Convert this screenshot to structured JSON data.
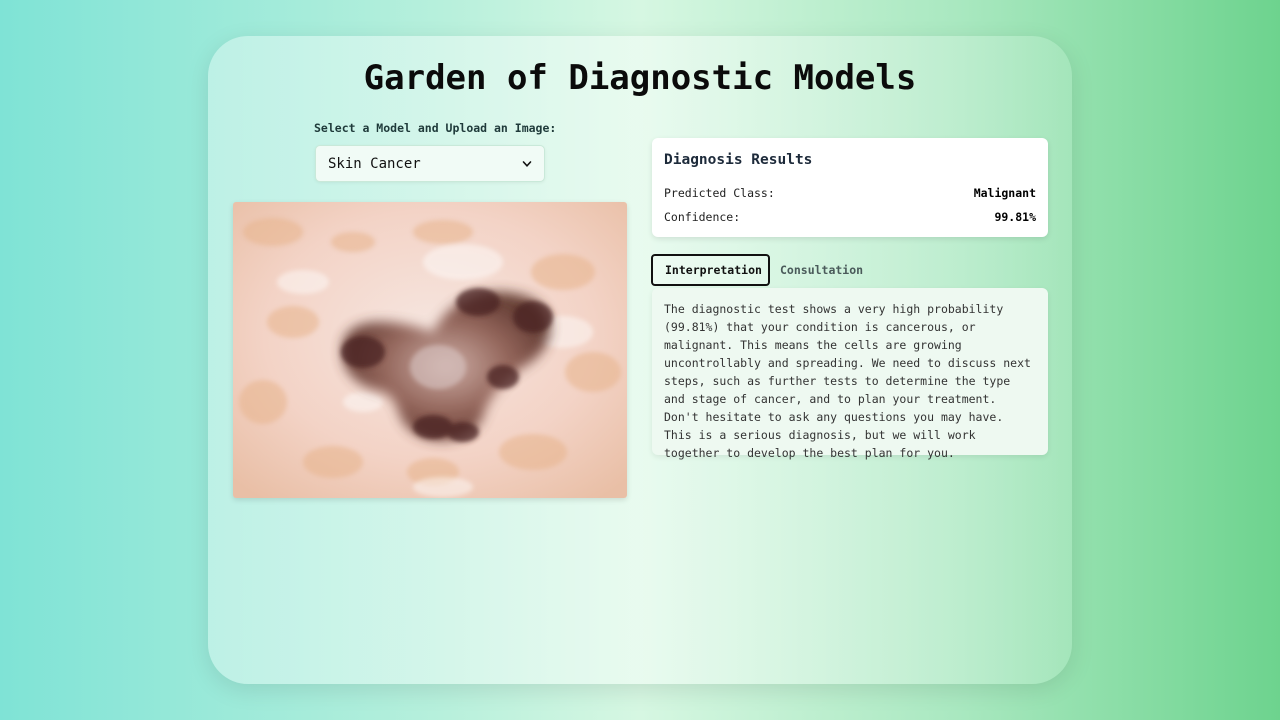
{
  "app": {
    "title": "Garden of Diagnostic Models"
  },
  "model_select": {
    "label": "Select a Model and Upload an Image:",
    "selected": "Skin Cancer"
  },
  "image": {
    "icon": "dermoscopy-lesion-image"
  },
  "results": {
    "heading": "Diagnosis Results",
    "predicted_label": "Predicted Class:",
    "predicted_value": "Malignant",
    "confidence_label": "Confidence:",
    "confidence_value": "99.81%"
  },
  "tabs": [
    {
      "label": "Interpretation",
      "active": true
    },
    {
      "label": "Consultation",
      "active": false
    }
  ],
  "interpretation": {
    "text": "The diagnostic test shows a very high probability (99.81%) that your condition is cancerous, or malignant. This means the cells are growing uncontrollably and spreading. We need to discuss next steps, such as further tests to determine the type and stage of cancer, and to plan your treatment. Don't hesitate to ask any questions you may have. This is a serious diagnosis, but we will work together to develop the best plan for you."
  },
  "colors": {
    "accent": "#111111",
    "card_bg": "#ffffff",
    "panel_bg": "#eef9f1"
  }
}
